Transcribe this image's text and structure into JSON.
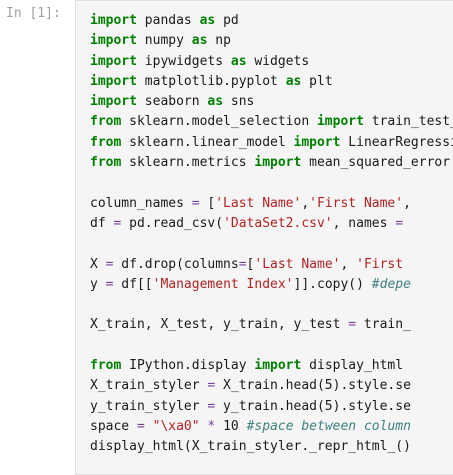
{
  "cell": {
    "prompt": "In [1]:",
    "lines": [
      [
        {
          "t": "kw",
          "v": "import"
        },
        {
          "t": "",
          "v": " pandas "
        },
        {
          "t": "kw",
          "v": "as"
        },
        {
          "t": "",
          "v": " pd"
        }
      ],
      [
        {
          "t": "kw",
          "v": "import"
        },
        {
          "t": "",
          "v": " numpy "
        },
        {
          "t": "kw",
          "v": "as"
        },
        {
          "t": "",
          "v": " np"
        }
      ],
      [
        {
          "t": "kw",
          "v": "import"
        },
        {
          "t": "",
          "v": " ipywidgets "
        },
        {
          "t": "kw",
          "v": "as"
        },
        {
          "t": "",
          "v": " widgets"
        }
      ],
      [
        {
          "t": "kw",
          "v": "import"
        },
        {
          "t": "",
          "v": " matplotlib.pyplot "
        },
        {
          "t": "kw",
          "v": "as"
        },
        {
          "t": "",
          "v": " plt"
        }
      ],
      [
        {
          "t": "kw",
          "v": "import"
        },
        {
          "t": "",
          "v": " seaborn "
        },
        {
          "t": "kw",
          "v": "as"
        },
        {
          "t": "",
          "v": " sns"
        }
      ],
      [
        {
          "t": "kw",
          "v": "from"
        },
        {
          "t": "",
          "v": " sklearn.model_selection "
        },
        {
          "t": "kw",
          "v": "import"
        },
        {
          "t": "",
          "v": " train_test_split"
        }
      ],
      [
        {
          "t": "kw",
          "v": "from"
        },
        {
          "t": "",
          "v": " sklearn.linear_model "
        },
        {
          "t": "kw",
          "v": "import"
        },
        {
          "t": "",
          "v": " LinearRegression"
        }
      ],
      [
        {
          "t": "kw",
          "v": "from"
        },
        {
          "t": "",
          "v": " sklearn.metrics "
        },
        {
          "t": "kw",
          "v": "import"
        },
        {
          "t": "",
          "v": " mean_squared_error"
        }
      ],
      [],
      [
        {
          "t": "",
          "v": "column_names "
        },
        {
          "t": "op",
          "v": "="
        },
        {
          "t": "",
          "v": " ["
        },
        {
          "t": "str",
          "v": "'Last Name'"
        },
        {
          "t": "",
          "v": ","
        },
        {
          "t": "str",
          "v": "'First Name'"
        },
        {
          "t": "",
          "v": ","
        }
      ],
      [
        {
          "t": "",
          "v": "df "
        },
        {
          "t": "op",
          "v": "="
        },
        {
          "t": "",
          "v": " pd.read_csv("
        },
        {
          "t": "str",
          "v": "'DataSet2.csv'"
        },
        {
          "t": "",
          "v": ", names "
        },
        {
          "t": "op",
          "v": "="
        }
      ],
      [],
      [
        {
          "t": "",
          "v": "X "
        },
        {
          "t": "op",
          "v": "="
        },
        {
          "t": "",
          "v": " df.drop(columns"
        },
        {
          "t": "op",
          "v": "="
        },
        {
          "t": "",
          "v": "["
        },
        {
          "t": "str",
          "v": "'Last Name'"
        },
        {
          "t": "",
          "v": ", "
        },
        {
          "t": "str",
          "v": "'First"
        }
      ],
      [
        {
          "t": "",
          "v": "y "
        },
        {
          "t": "op",
          "v": "="
        },
        {
          "t": "",
          "v": " df[["
        },
        {
          "t": "str",
          "v": "'Management Index'"
        },
        {
          "t": "",
          "v": "]].copy() "
        },
        {
          "t": "com",
          "v": "#depe"
        }
      ],
      [],
      [
        {
          "t": "",
          "v": "X_train, X_test, y_train, y_test "
        },
        {
          "t": "op",
          "v": "="
        },
        {
          "t": "",
          "v": " train_"
        }
      ],
      [],
      [
        {
          "t": "kw",
          "v": "from"
        },
        {
          "t": "",
          "v": " IPython.display "
        },
        {
          "t": "kw",
          "v": "import"
        },
        {
          "t": "",
          "v": " display_html"
        }
      ],
      [
        {
          "t": "",
          "v": "X_train_styler "
        },
        {
          "t": "op",
          "v": "="
        },
        {
          "t": "",
          "v": " X_train.head(5).style.se"
        }
      ],
      [
        {
          "t": "",
          "v": "y_train_styler "
        },
        {
          "t": "op",
          "v": "="
        },
        {
          "t": "",
          "v": " y_train.head(5).style.se"
        }
      ],
      [
        {
          "t": "",
          "v": "space "
        },
        {
          "t": "op",
          "v": "="
        },
        {
          "t": "",
          "v": " "
        },
        {
          "t": "str",
          "v": "\"\\xa0\""
        },
        {
          "t": "",
          "v": " "
        },
        {
          "t": "op",
          "v": "*"
        },
        {
          "t": "",
          "v": " 10 "
        },
        {
          "t": "com",
          "v": "#space between column"
        }
      ],
      [
        {
          "t": "",
          "v": "display_html(X_train_styler._repr_html_()"
        }
      ]
    ]
  }
}
